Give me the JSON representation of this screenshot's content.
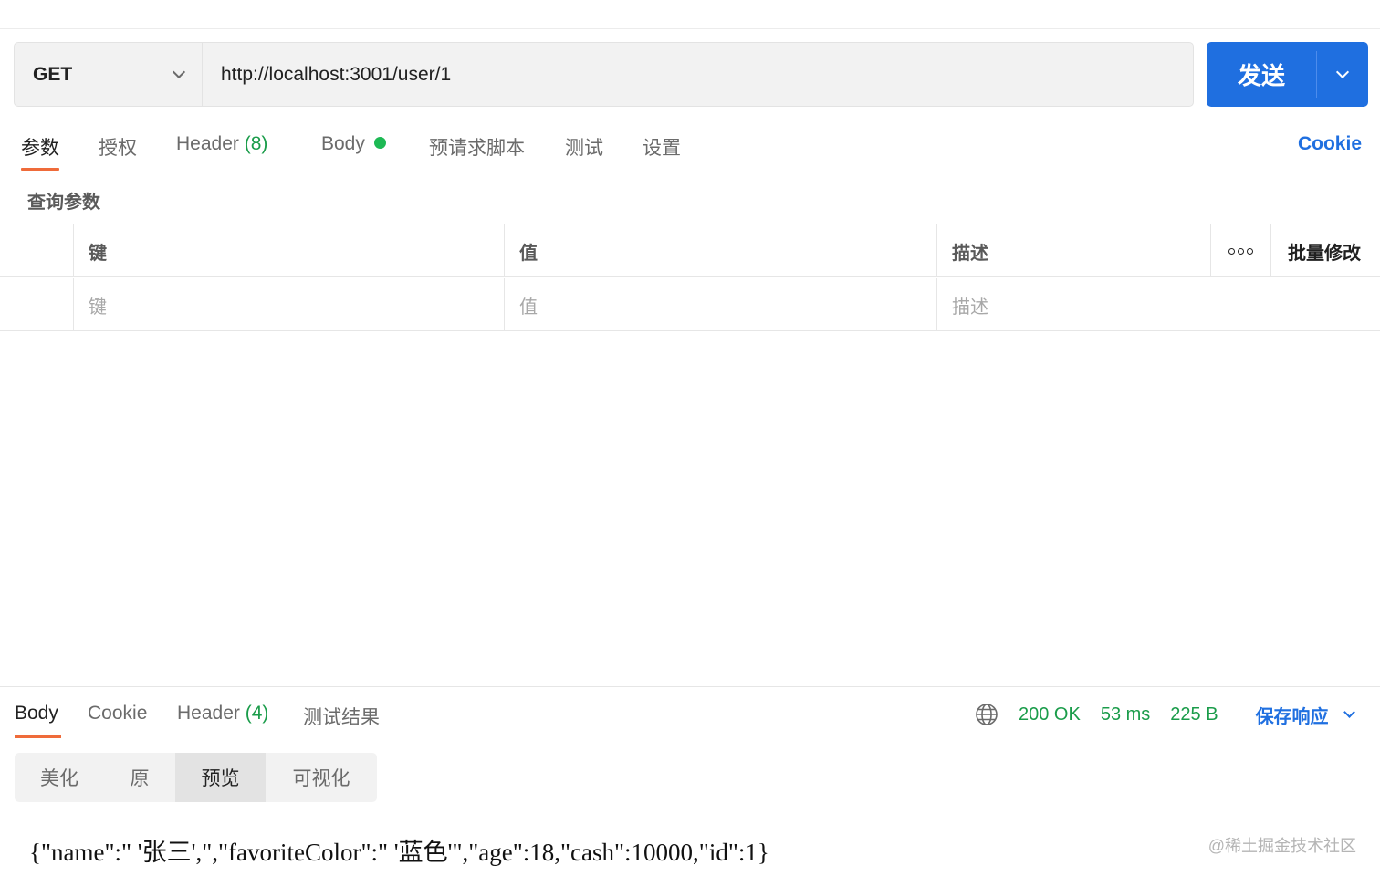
{
  "request": {
    "method": "GET",
    "url": "http://localhost:3001/user/1",
    "send_label": "发送"
  },
  "request_tabs": {
    "params": "参数",
    "auth": "授权",
    "header": "Header",
    "header_count": "(8)",
    "body": "Body",
    "prerequest": "预请求脚本",
    "tests": "测试",
    "settings": "设置",
    "cookie_link": "Cookie"
  },
  "params": {
    "section_title": "查询参数",
    "columns": {
      "key": "键",
      "value": "值",
      "description": "描述",
      "bulk_edit": "批量修改"
    },
    "placeholders": {
      "key": "键",
      "value": "值",
      "description": "描述"
    }
  },
  "response_tabs": {
    "body": "Body",
    "cookie": "Cookie",
    "header": "Header",
    "header_count": "(4)",
    "test_results": "测试结果"
  },
  "response_status": {
    "status": "200 OK",
    "time": "53 ms",
    "size": "225 B",
    "save_label": "保存响应"
  },
  "view_modes": {
    "pretty": "美化",
    "raw": "原",
    "preview": "预览",
    "visualize": "可视化",
    "selected": "预览"
  },
  "preview_text": "{\"name\":\" '张三',\",\"favoriteColor\":\" '蓝色'\",\"age\":18,\"cash\":10000,\"id\":1}",
  "watermark": "@稀土掘金技术社区",
  "colors": {
    "accent": "#1f6fe0",
    "tab_underline": "#ef6b3a",
    "status_green": "#1a9c4a"
  }
}
